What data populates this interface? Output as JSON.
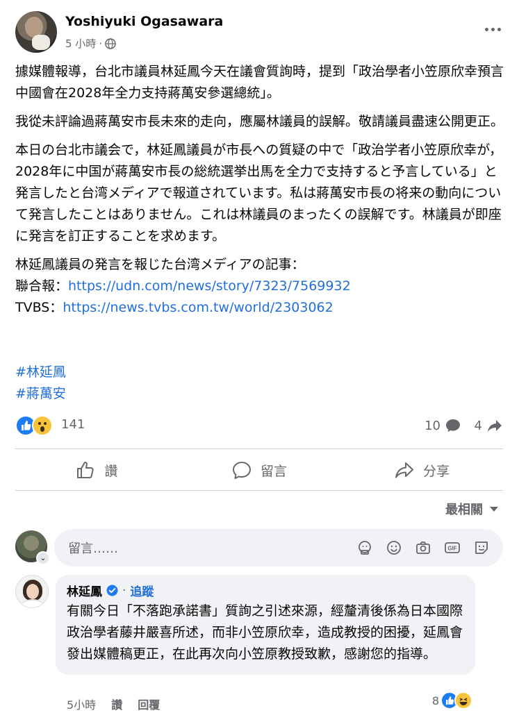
{
  "post": {
    "author": "Yoshiyuki Ogasawara",
    "time": "5 小時",
    "paragraphs": [
      "據媒體報導，台北市議員林延鳳今天在議會質詢時，提到「政治學者小笠原欣幸預言中國會在2028年全力支持蔣萬安參選總統」。",
      "我從未評論過蔣萬安市長未來的走向，應屬林議員的誤解。敬請議員盡速公開更正。",
      "本日の台北市議会で，林延鳳議員が市長への質疑の中で「政治学者小笠原欣幸が，2028年に中国が蔣萬安市長の総統選挙出馬を全力で支持すると予言している」と発言したと台湾メディアで報道されています。私は蔣萬安市長の将来の動向について発言したことはありません。これは林議員のまったくの誤解です。林議員が即座に発言を訂正することを求めます。"
    ],
    "sources_heading": "林延鳳議員の発言を報じた台湾メディアの記事：",
    "source1_label": "聯合報：",
    "source1_url": "https://udn.com/news/story/7323/7569932",
    "source2_label": "TVBS：",
    "source2_url": "https://news.tvbs.com.tw/world/2303062",
    "hashtags": [
      "#林延鳳",
      "#蔣萬安"
    ]
  },
  "stats": {
    "reactions": "141",
    "comments": "10",
    "shares": "4"
  },
  "actions": {
    "like": "讚",
    "comment": "留言",
    "share": "分享"
  },
  "sort": {
    "label": "最相關"
  },
  "composer": {
    "placeholder": "留言……"
  },
  "comment": {
    "name": "林延鳳",
    "follow": "追蹤",
    "text": "有關今日「不落跑承諾書」質詢之引述來源，經釐清後係為日本國際政治學者藤井嚴喜所述，而非小笠原欣幸，造成教授的困擾，延鳳會發出媒體稿更正，在此再次向小笠原教授致歉，感謝您的指導。",
    "time": "5小時",
    "like": "讚",
    "reply": "回覆",
    "reactions": "8"
  },
  "colors": {
    "link": "#216fdb",
    "like_blue": "#1d7cf2",
    "muted": "#65676b"
  }
}
